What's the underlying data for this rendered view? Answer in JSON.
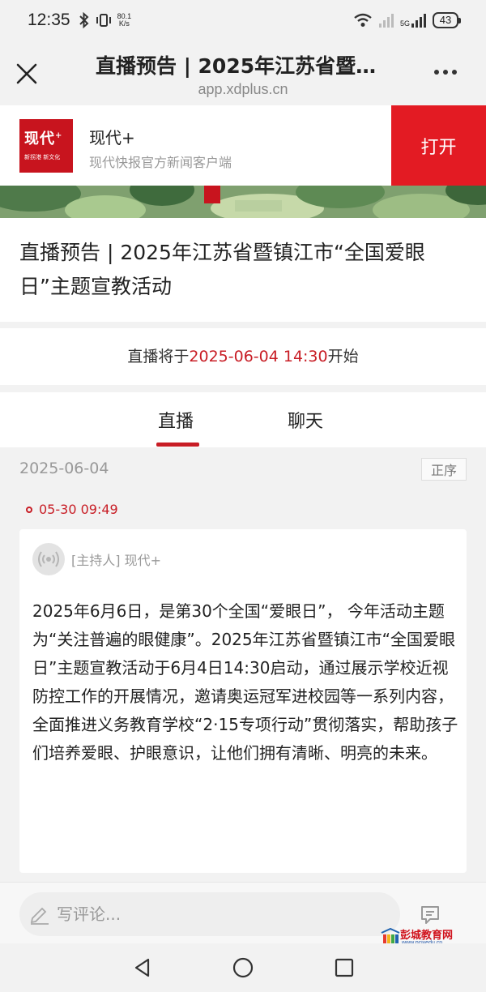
{
  "status_bar": {
    "time": "12:35",
    "net_speed_value": "80.1",
    "net_speed_unit": "K/s",
    "battery": "43",
    "network_label": "5G"
  },
  "nav": {
    "title": "直播预告 | 2025年江苏省暨…",
    "url": "app.xdplus.cn"
  },
  "app_banner": {
    "logo_text": "现代",
    "logo_sup": "+",
    "logo_tagline": "新拐港 新文化",
    "name": "现代+",
    "desc": "现代快报官方新闻客户端",
    "open_label": "打开"
  },
  "article": {
    "title": "直播预告 | 2025年江苏省暨镇江市“全国爱眼日”主题宣教活动",
    "schedule_prefix": "直播将于",
    "schedule_time": "2025-06-04 14:30",
    "schedule_suffix": "开始"
  },
  "tabs": [
    {
      "label": "直播",
      "active": true
    },
    {
      "label": "聊天",
      "active": false
    }
  ],
  "feed": {
    "date": "2025-06-04",
    "order_label": "正序",
    "post": {
      "time": "05-30 09:49",
      "author": "[主持人] 现代+",
      "body": "2025年6月6日，是第30个全国“爱眼日”， 今年活动主题为“关注普遍的眼健康”。2025年江苏省暨镇江市“全国爱眼日”主题宣教活动于6月4日14:30启动，通过展示学校近视防控工作的开展情况，邀请奥运冠军进校园等一系列内容，全面推进义务教育学校“2·15专项行动”贯彻落实，帮助孩子们培养爱眼、护眼意识，让他们拥有清晰、明亮的未来。"
    }
  },
  "comment": {
    "placeholder": "写评论..."
  },
  "watermark": {
    "text": "彭城教育网",
    "url": "www.pcjyedu.cn"
  },
  "colors": {
    "brand_red": "#e31b23",
    "accent_red": "#c81d25"
  }
}
